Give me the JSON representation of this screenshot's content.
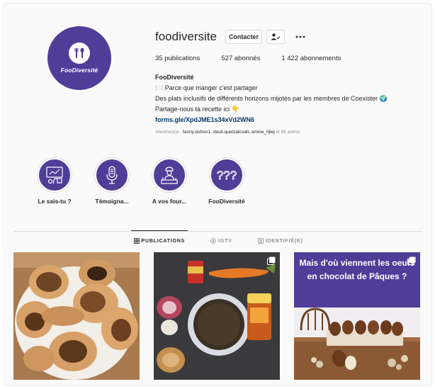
{
  "profile": {
    "username": "foodiversite",
    "avatar_text": "FooDiversité",
    "contact_label": "Contacter",
    "follow_icon": "person-check-icon",
    "more_icon": "more-dots-icon",
    "stats": {
      "posts": "35 publications",
      "followers": "527 abonnés",
      "following": "1 422 abonnements"
    },
    "bio": {
      "name": "FooDiversité",
      "line1": "🍽️ Parce que manger c'est partager",
      "line2": "Des plats inclusifs de différents horizons mijotés par les membres de Coexister 🌍",
      "line3": "Partage-nous ta recette ici 👇",
      "link": "forms.gle/XpdJME1s34xVd2WN6"
    },
    "followers_prefix": "Abonné(e)s : ",
    "followers_names": "fanny.dufour1, deuil.quetzalcoatl, amine_hjlej",
    "followers_suffix": " et 66 autres"
  },
  "highlights": [
    {
      "label": "Le sais-tu ?",
      "icon": "presentation-icon"
    },
    {
      "label": "Témoigna...",
      "icon": "microphone-icon"
    },
    {
      "label": "A vos four...",
      "icon": "chef-icon"
    },
    {
      "label": "FooDiversité",
      "icon": "question-marks-icon"
    }
  ],
  "tabs": [
    {
      "label": "PUBLICATIONS",
      "icon": "grid-icon",
      "active": true
    },
    {
      "label": "IGTV",
      "icon": "igtv-icon",
      "active": false
    },
    {
      "label": "IDENTIFIÉ(E)",
      "icon": "tagged-icon",
      "active": false
    }
  ],
  "posts": [
    {
      "alt": "flatbreads-photo",
      "multi": false
    },
    {
      "alt": "ingredients-photo",
      "multi": true
    },
    {
      "caption": "Mais d'où viennent les oeufs en chocolat de Pâques ?",
      "multi": true
    }
  ],
  "colors": {
    "brand_purple": "#4f3d98",
    "link_blue": "#00376b"
  }
}
